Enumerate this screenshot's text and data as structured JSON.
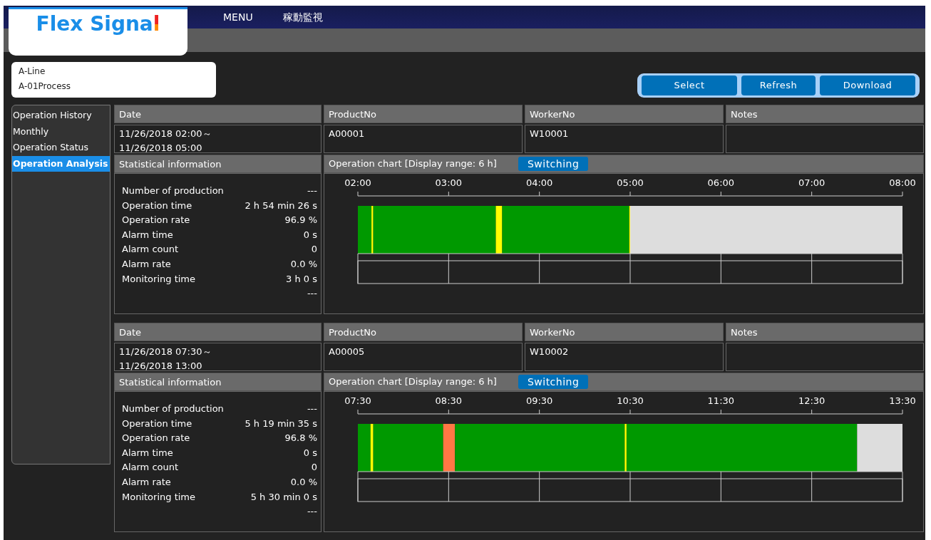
{
  "logo": {
    "text": "Flex Signal"
  },
  "menu": [
    {
      "label": "MENU"
    },
    {
      "label": "稼動監視"
    }
  ],
  "location": {
    "line": "A-Line",
    "process": "A-01Process"
  },
  "buttons": [
    "Select",
    "Refresh",
    "Download"
  ],
  "sidebar": {
    "items": [
      {
        "label": "Operation History",
        "selected": false
      },
      {
        "label": "Monthly",
        "selected": false
      },
      {
        "label": "Operation Status",
        "selected": false
      },
      {
        "label": "Operation Analysis",
        "selected": true
      }
    ]
  },
  "records": [
    {
      "columns": [
        "Date",
        "ProductNo",
        "WorkerNo",
        "Notes"
      ],
      "date_from": "11/26/2018 02:00～",
      "date_to": "11/26/2018 05:00",
      "product_no": "A00001",
      "worker_no": "W10001",
      "stats_title": "Statistical information",
      "stats": [
        {
          "label": "Number of production",
          "value": "---"
        },
        {
          "label": "Operation time",
          "value": "2 h 54 min 26 s"
        },
        {
          "label": "Operation rate",
          "value": "96.9 %"
        },
        {
          "label": "Alarm time",
          "value": "0 s"
        },
        {
          "label": "Alarm count",
          "value": "0"
        },
        {
          "label": "Alarm rate",
          "value": "0.0 %"
        },
        {
          "label": "Monitoring time",
          "value": "3 h 0 s"
        },
        {
          "value": "---"
        }
      ],
      "chart_title": "Operation chart  [Display range: 6 h]",
      "switch_button": "Switching",
      "time_labels": [
        "02:00",
        "03:00",
        "04:00",
        "05:00",
        "06:00",
        "07:00",
        "08:00"
      ]
    },
    {
      "columns": [
        "Date",
        "ProductNo",
        "WorkerNo",
        "Notes"
      ],
      "date_from": "11/26/2018 07:30～",
      "date_to": "11/26/2018 13:00",
      "product_no": "A00005",
      "worker_no": "W10002",
      "stats_title": "Statistical information",
      "stats": [
        {
          "label": "Number of production",
          "value": "---"
        },
        {
          "label": "Operation time",
          "value": "5 h 19 min 35 s"
        },
        {
          "label": "Operation rate",
          "value": "96.8 %"
        },
        {
          "label": "Alarm time",
          "value": "0 s"
        },
        {
          "label": "Alarm count",
          "value": "0"
        },
        {
          "label": "Alarm rate",
          "value": "0.0 %"
        },
        {
          "label": "Monitoring time",
          "value": "5 h 30 min 0 s"
        },
        {
          "value": "---"
        }
      ],
      "chart_title": "Operation chart  [Display range: 6 h]",
      "switch_button": "Switching",
      "time_labels": [
        "07:30",
        "08:30",
        "09:30",
        "10:30",
        "11:30",
        "12:30",
        "13:30"
      ]
    }
  ]
}
